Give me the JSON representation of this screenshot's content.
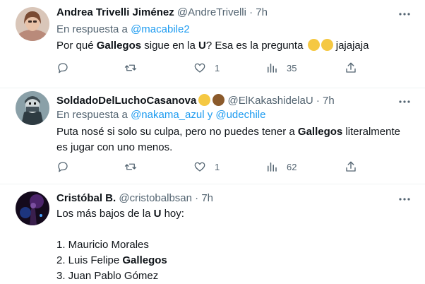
{
  "tweets": [
    {
      "name": "Andrea Trivelli Jiménez",
      "handle": "@AndreTrivelli",
      "dot": "·",
      "time": "7h",
      "reply_prefix": "En respuesta a",
      "reply_to": "@macabile2",
      "text": {
        "p1": "Por qué ",
        "b1": "Gallegos",
        "p2": " sigue en la ",
        "b2": "U",
        "p3": "? Esa es la pregunta ",
        "p4": " jajajaja"
      },
      "stats": {
        "replies": "",
        "retweets": "",
        "likes": "1",
        "views": "35"
      }
    },
    {
      "name": "SoldadoDelLuchoCasanova",
      "handle": "@ElKakashidelaU",
      "dot": "·",
      "time": "7h",
      "reply_prefix": "En respuesta a",
      "reply_to": "@nakama_azul y @udechile",
      "text": {
        "p1": "Puta nosé si solo su culpa, pero no puedes tener a ",
        "b1": "Gallegos",
        "p2": " literalmente es jugar con uno menos."
      },
      "stats": {
        "replies": "",
        "retweets": "",
        "likes": "1",
        "views": "62"
      }
    },
    {
      "name": "Cristóbal B.",
      "handle": "@cristobalbsan",
      "dot": "·",
      "time": "7h",
      "text": {
        "p1": "Los más bajos de la ",
        "b1": "U",
        "p2": " hoy:",
        "l1": "1. Mauricio Morales",
        "l2a": "2. Luis Felipe ",
        "l2b": "Gallegos",
        "l3": "3. Juan Pablo Gómez"
      }
    }
  ],
  "icons": {
    "reply": "reply-icon",
    "retweet": "retweet-icon",
    "like": "heart-icon",
    "views": "views-icon",
    "share": "share-icon",
    "more": "more-icon"
  },
  "colors": {
    "link": "#1d9bf0",
    "secondary": "#536471",
    "text": "#0f1419"
  }
}
